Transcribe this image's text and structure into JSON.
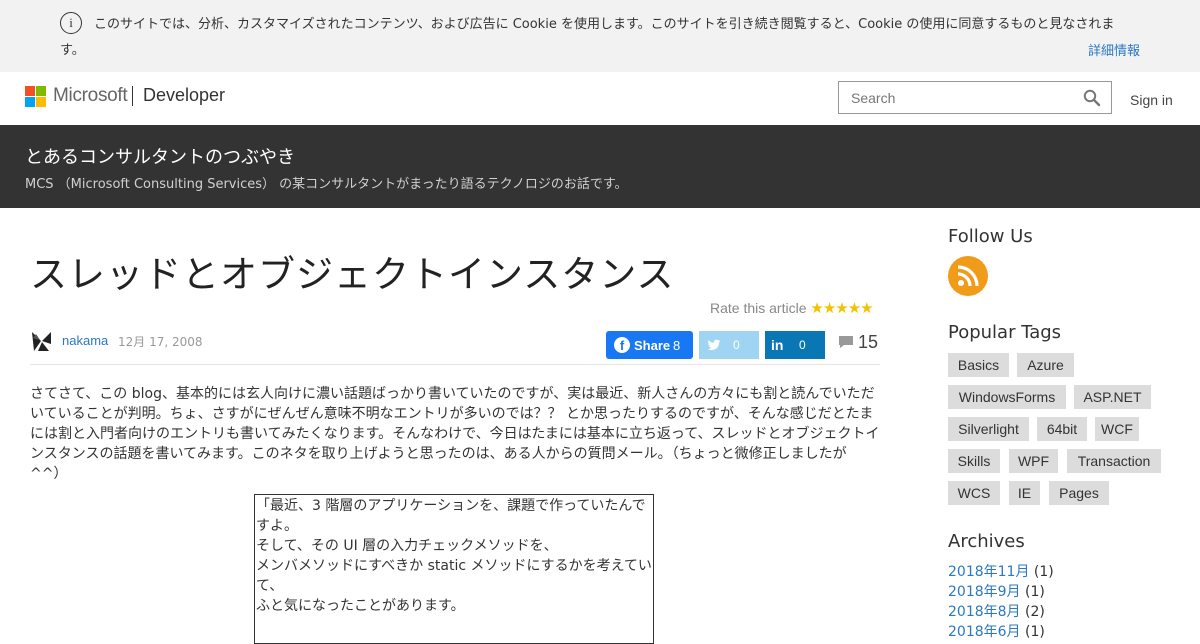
{
  "cookie_banner": {
    "message": "このサイトでは、分析、カスタマイズされたコンテンツ、および広告に Cookie を使用します。このサイトを引き続き閲覧すると、Cookie の使用に同意するものと見なされます。",
    "more_link": "詳細情報"
  },
  "header": {
    "brand": "Microsoft",
    "section": "Developer",
    "search_placeholder": "Search",
    "sign_in": "Sign in",
    "logo_colors": [
      "#f25022",
      "#7fba00",
      "#00a4ef",
      "#ffb900"
    ]
  },
  "blog": {
    "title": "とあるコンサルタントのつぶやき",
    "subtitle": "MCS （Microsoft Consulting Services） の某コンサルタントがまったり語るテクノロジのお話です。"
  },
  "article": {
    "title": "スレッドとオブジェクトインスタンス",
    "rate_label": "Rate this article",
    "stars": "★★★★★",
    "author": "nakama",
    "date": "12月 17, 2008",
    "share": {
      "facebook_label": "Share",
      "facebook_count": "8",
      "twitter_count": "0",
      "linkedin_label": "in",
      "linkedin_count": "0"
    },
    "comment_count": "15",
    "body": "さてさて、この blog、基本的には玄人向けに濃い話題ばっかり書いていたのですが、実は最近、新人さんの方々にも割と読んでいただいていることが判明。ちょ、さすがにぜんぜん意味不明なエントリが多いのでは？？ とか思ったりするのですが、そんな感じだとたまには割と入門者向けのエントリも書いてみたくなります。そんなわけで、今日はたまには基本に立ち返って、スレッドとオブジェクトインスタンスの話題を書いてみます。このネタを取り上げようと思ったのは、ある人からの質問メール。（ちょっと微修正しましたが ^^）",
    "quote_lines": [
      "「最近、3 階層のアプリケーションを、課題で作っていたんですよ。",
      "そして、その UI 層の入力チェックメソッドを、",
      "メンバメソッドにすべきか static メソッドにするかを考えていて、",
      "ふと気になったことがあります。"
    ]
  },
  "sidebar": {
    "follow_heading": "Follow Us",
    "tags_heading": "Popular Tags",
    "tags": [
      "Basics",
      "Azure",
      "WindowsForms",
      "ASP.NET",
      "Silverlight",
      "64bit",
      "WCF",
      "Skills",
      "WPF",
      "Transaction",
      "WCS",
      "IE",
      "Pages"
    ],
    "archives_heading": "Archives",
    "archives": [
      {
        "label": "2018年11月",
        "count": "(1)"
      },
      {
        "label": "2018年9月",
        "count": "(1)"
      },
      {
        "label": "2018年8月",
        "count": "(2)"
      },
      {
        "label": "2018年6月",
        "count": "(1)"
      }
    ]
  }
}
